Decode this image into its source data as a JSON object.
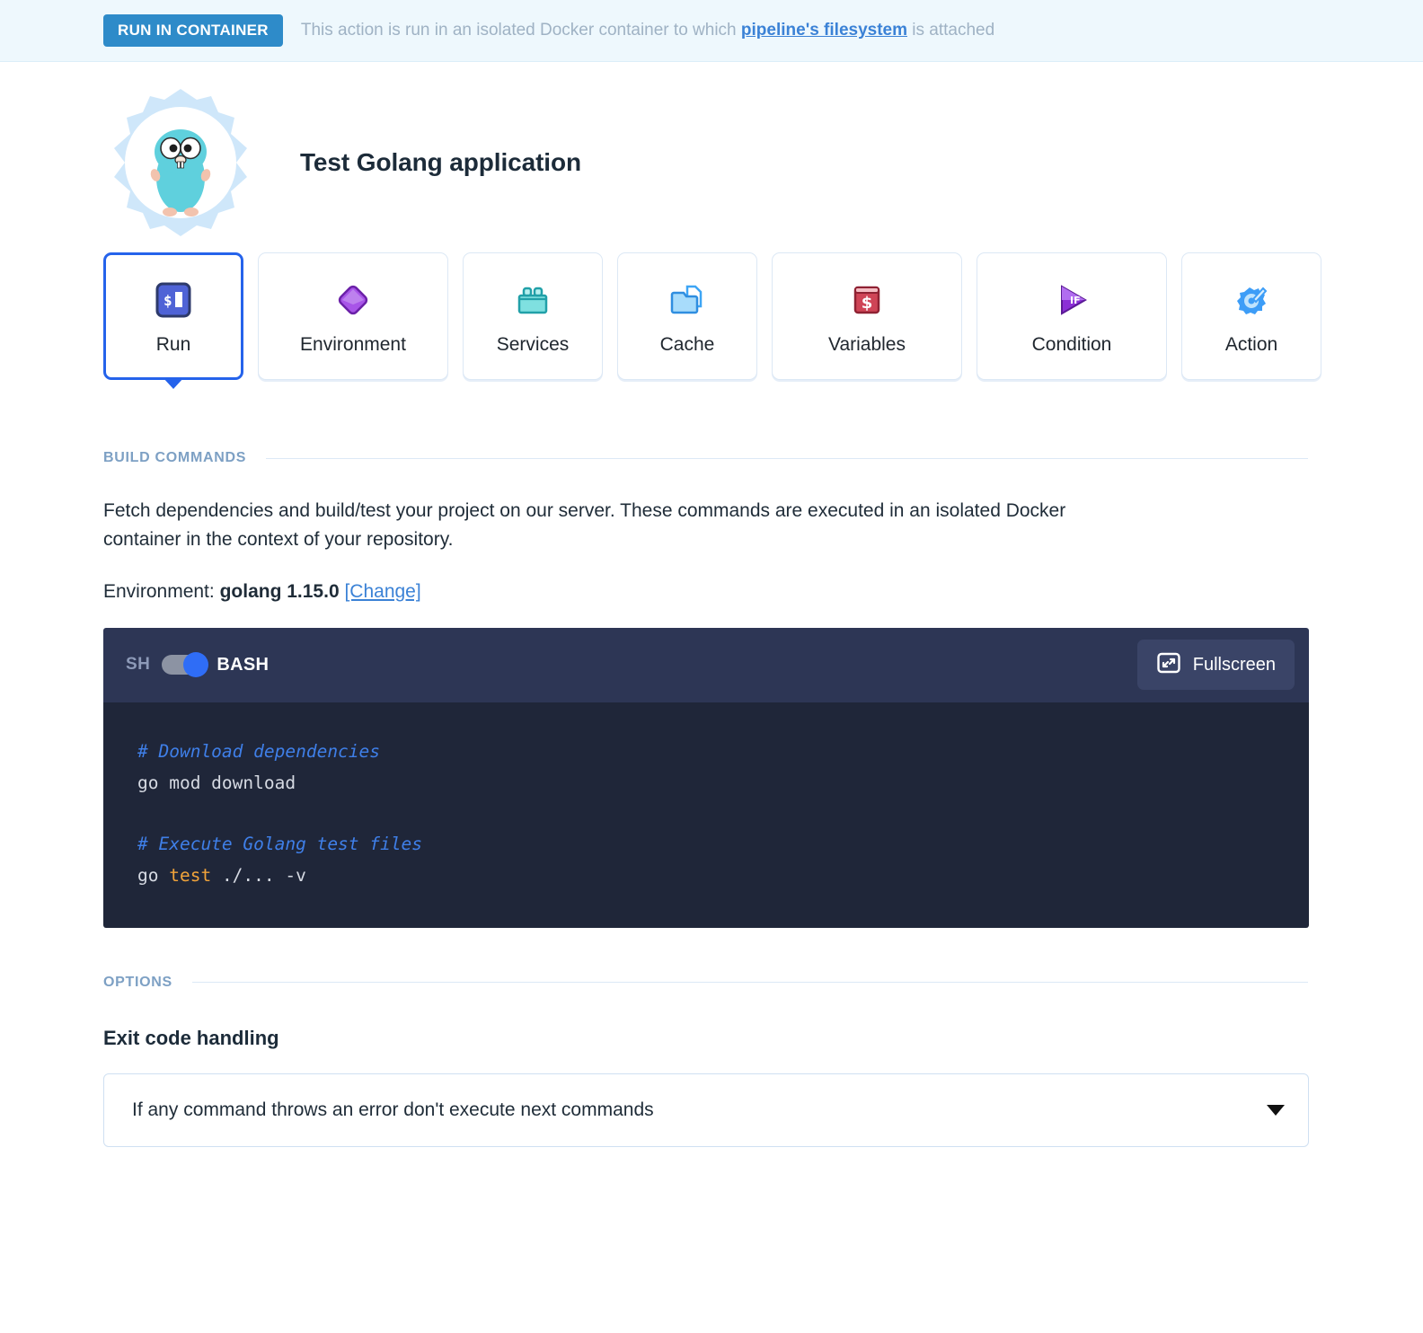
{
  "banner": {
    "badge": "RUN IN CONTAINER",
    "text_before": "This action is run in an isolated Docker container to which ",
    "link": "pipeline's filesystem",
    "text_after": " is attached",
    "badge_color": "#2e8bc9",
    "background": "#eef8fd"
  },
  "header": {
    "title": "Test Golang application",
    "logo_icon": "golang-gopher-gear-icon"
  },
  "tabs": [
    {
      "label": "Run",
      "icon": "terminal-prompt-icon",
      "active": true
    },
    {
      "label": "Environment",
      "icon": "purple-diamond-icon",
      "active": false
    },
    {
      "label": "Services",
      "icon": "teal-crate-icon",
      "active": false
    },
    {
      "label": "Cache",
      "icon": "folder-document-icon",
      "active": false
    },
    {
      "label": "Variables",
      "icon": "red-dollar-card-icon",
      "active": false
    },
    {
      "label": "Condition",
      "icon": "if-play-icon",
      "active": false
    },
    {
      "label": "Action",
      "icon": "gear-wrench-icon",
      "active": false
    }
  ],
  "build_commands": {
    "section_title": "BUILD COMMANDS",
    "description": "Fetch dependencies and build/test your project on our server. These commands are executed in an isolated Docker container in the context of your repository.",
    "environment_prefix": "Environment:",
    "environment_value": "golang 1.15.0",
    "environment_change_link": "[Change]"
  },
  "editor": {
    "shell_left_label": "SH",
    "shell_right_label": "BASH",
    "toggle_state": "BASH",
    "fullscreen_label": "Fullscreen",
    "fullscreen_icon": "expand-fullscreen-icon",
    "code_lines": [
      {
        "type": "comment",
        "text": "# Download dependencies"
      },
      {
        "type": "plain",
        "text": "go mod download"
      },
      {
        "type": "blank",
        "text": ""
      },
      {
        "type": "comment",
        "text": "# Execute Golang test files"
      },
      {
        "type": "keyword",
        "pre": "go ",
        "kw": "test",
        "post": " ./... -v"
      }
    ]
  },
  "options": {
    "section_title": "OPTIONS",
    "exit_code_label": "Exit code handling",
    "exit_code_value": "If any command throws an error don't execute next commands",
    "caret_icon": "chevron-down-icon"
  }
}
